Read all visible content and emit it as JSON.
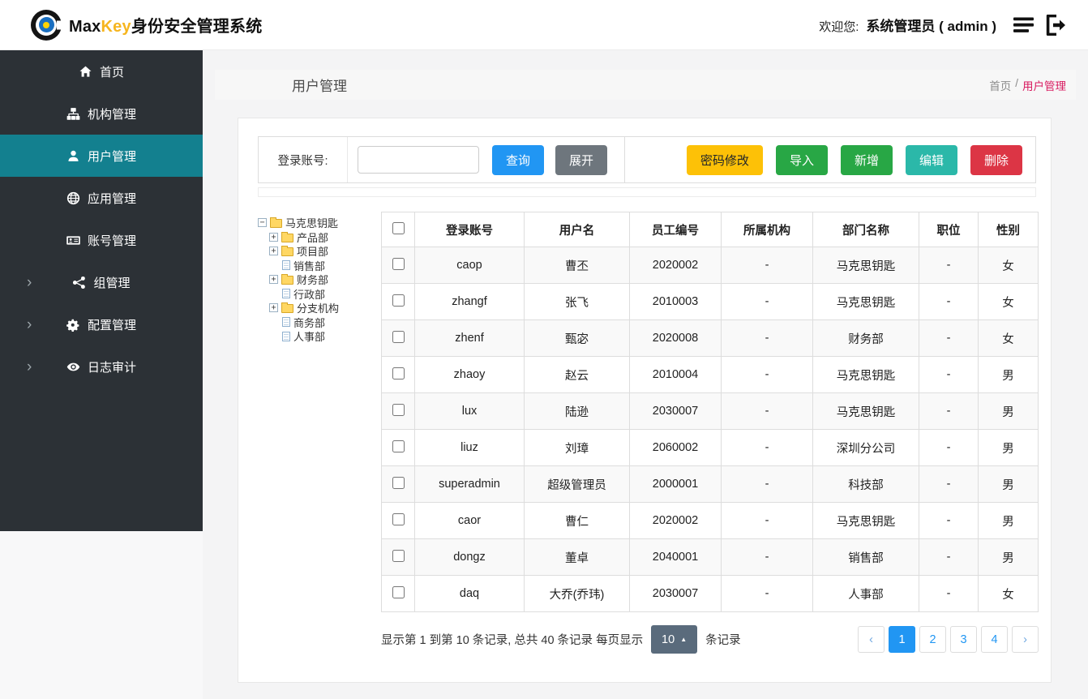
{
  "header": {
    "brand_max": "Max",
    "brand_key": "Key",
    "brand_suffix": "身份安全管理系统",
    "welcome_label": "欢迎您:",
    "welcome_user": "系统管理员 ( admin )"
  },
  "sidebar": {
    "items": [
      {
        "key": "home",
        "icon": "home-icon",
        "label": "首页",
        "active": false,
        "chevron": false
      },
      {
        "key": "org",
        "icon": "sitemap-icon",
        "label": "机构管理",
        "active": false,
        "chevron": false
      },
      {
        "key": "users",
        "icon": "user-icon",
        "label": "用户管理",
        "active": true,
        "chevron": false
      },
      {
        "key": "apps",
        "icon": "globe-icon",
        "label": "应用管理",
        "active": false,
        "chevron": false
      },
      {
        "key": "accounts",
        "icon": "idcard-icon",
        "label": "账号管理",
        "active": false,
        "chevron": false
      },
      {
        "key": "groups",
        "icon": "share-icon",
        "label": "组管理",
        "active": false,
        "chevron": true
      },
      {
        "key": "config",
        "icon": "gear-icon",
        "label": "配置管理",
        "active": false,
        "chevron": true
      },
      {
        "key": "audit",
        "icon": "eye-icon",
        "label": "日志审计",
        "active": false,
        "chevron": true
      }
    ]
  },
  "page": {
    "title": "用户管理",
    "breadcrumb_home": "首页",
    "breadcrumb_sep": "/",
    "breadcrumb_current": "用户管理"
  },
  "toolbar": {
    "login_label": "登录账号:",
    "search_button": "查询",
    "expand_button": "展开",
    "actions": [
      {
        "key": "password-change",
        "label": "密码修改",
        "bg": "#fdc107",
        "fg": "#212529"
      },
      {
        "key": "import",
        "label": "导入",
        "bg": "#28a745",
        "fg": "#ffffff"
      },
      {
        "key": "add",
        "label": "新增",
        "bg": "#28a745",
        "fg": "#ffffff"
      },
      {
        "key": "edit",
        "label": "编辑",
        "bg": "#2bb8a9",
        "fg": "#ffffff"
      },
      {
        "key": "delete",
        "label": "删除",
        "bg": "#dc3545",
        "fg": "#ffffff"
      }
    ]
  },
  "tree": {
    "root": "马克思钥匙",
    "nodes": [
      {
        "label": "产品部",
        "type": "folder"
      },
      {
        "label": "项目部",
        "type": "folder"
      },
      {
        "label": "销售部",
        "type": "file"
      },
      {
        "label": "财务部",
        "type": "folder"
      },
      {
        "label": "行政部",
        "type": "file"
      },
      {
        "label": "分支机构",
        "type": "folder"
      },
      {
        "label": "商务部",
        "type": "file"
      },
      {
        "label": "人事部",
        "type": "file"
      }
    ]
  },
  "table": {
    "columns": [
      "登录账号",
      "用户名",
      "员工编号",
      "所属机构",
      "部门名称",
      "职位",
      "性别"
    ],
    "rows": [
      [
        "caop",
        "曹丕",
        "2020002",
        "-",
        "马克思钥匙",
        "-",
        "女"
      ],
      [
        "zhangf",
        "张飞",
        "2010003",
        "-",
        "马克思钥匙",
        "-",
        "女"
      ],
      [
        "zhenf",
        "甄宓",
        "2020008",
        "-",
        "财务部",
        "-",
        "女"
      ],
      [
        "zhaoy",
        "赵云",
        "2010004",
        "-",
        "马克思钥匙",
        "-",
        "男"
      ],
      [
        "lux",
        "陆逊",
        "2030007",
        "-",
        "马克思钥匙",
        "-",
        "男"
      ],
      [
        "liuz",
        "刘璋",
        "2060002",
        "-",
        "深圳分公司",
        "-",
        "男"
      ],
      [
        "superadmin",
        "超级管理员",
        "2000001",
        "-",
        "科技部",
        "-",
        "男"
      ],
      [
        "caor",
        "曹仁",
        "2020002",
        "-",
        "马克思钥匙",
        "-",
        "男"
      ],
      [
        "dongz",
        "董卓",
        "2040001",
        "-",
        "销售部",
        "-",
        "男"
      ],
      [
        "daq",
        "大乔(乔玮)",
        "2030007",
        "-",
        "人事部",
        "-",
        "女"
      ]
    ]
  },
  "pagination": {
    "summary_prefix": "显示第 1 到第 10 条记录, 总共 40 条记录 每页显示",
    "page_size": "10",
    "summary_suffix": "条记录",
    "prev": "‹",
    "next": "›",
    "pages": [
      "1",
      "2",
      "3",
      "4"
    ],
    "active_page": "1"
  }
}
